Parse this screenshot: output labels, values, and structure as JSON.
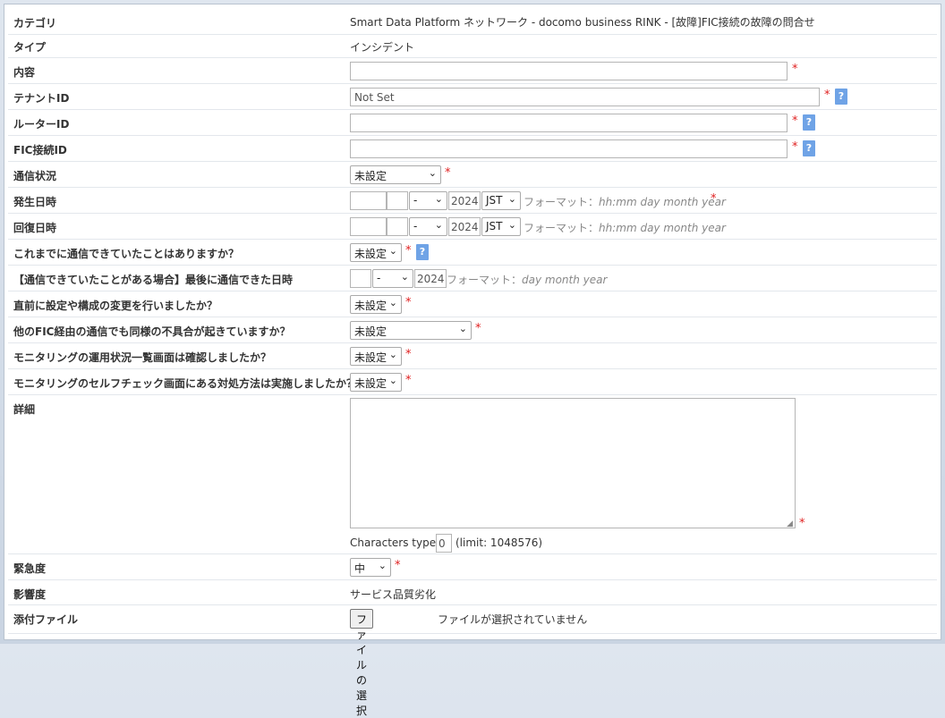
{
  "category": {
    "label": "カテゴリ",
    "value": "Smart Data Platform ネットワーク - docomo business RINK - [故障]FIC接続の故障の問合せ"
  },
  "type": {
    "label": "タイプ",
    "value": "インシデント"
  },
  "content": {
    "label": "内容",
    "value": ""
  },
  "tenant_id": {
    "label": "テナントID",
    "value": "Not Set"
  },
  "router_id": {
    "label": "ルーターID",
    "value": ""
  },
  "fic_id": {
    "label": "FIC接続ID",
    "value": ""
  },
  "comm_status": {
    "label": "通信状況",
    "value": "未設定"
  },
  "occurred": {
    "label": "発生日時",
    "month": "-",
    "year": "2024",
    "tz": "JST",
    "format_prefix": "フォーマット：",
    "format": "hh:mm day month year"
  },
  "recovered": {
    "label": "回復日時",
    "month": "-",
    "year": "2024",
    "tz": "JST",
    "format_prefix": "フォーマット：",
    "format": "hh:mm day month year"
  },
  "q_prev_comm": {
    "label": "これまでに通信できていたことはありますか？",
    "value": "未設定"
  },
  "last_comm": {
    "label": "【通信できていたことがある場合】最後に通信できた日時",
    "month": "-",
    "year": "2024",
    "format_prefix": "フォーマット：",
    "format": "day month year"
  },
  "q_change": {
    "label": "直前に設定や構成の変更を行いましたか？",
    "value": "未設定"
  },
  "q_other_fic": {
    "label": "他のFIC経由の通信でも同様の不具合が起きていますか？",
    "value": "未設定"
  },
  "q_monitor_list": {
    "label": "モニタリングの運用状況一覧画面は確認しましたか？",
    "value": "未設定"
  },
  "q_self_check": {
    "label": "モニタリングのセルフチェック画面にある対処方法は実施しましたか？",
    "value": "未設定"
  },
  "details": {
    "label": "詳細",
    "chars_label": "Characters typed:",
    "chars_value": "0",
    "limit": "(limit: 1048576)"
  },
  "urgency": {
    "label": "緊急度",
    "value": "中"
  },
  "impact": {
    "label": "影響度",
    "value": "サービス品質劣化"
  },
  "attachment": {
    "label": "添付ファイル",
    "button": "ファイルの選択",
    "status": "ファイルが選択されていません"
  },
  "required_mark": "*",
  "help_mark": "?"
}
